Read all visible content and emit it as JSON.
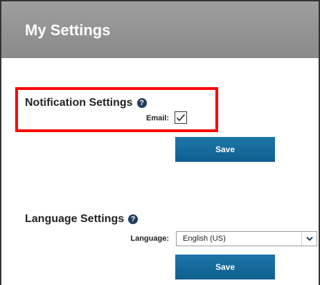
{
  "header": {
    "title": "My Settings"
  },
  "notification": {
    "title": "Notification Settings",
    "help_icon": "?",
    "email_label": "Email:",
    "email_checked": true,
    "save_label": "Save"
  },
  "language": {
    "title": "Language Settings",
    "help_icon": "?",
    "language_label": "Language:",
    "language_value": "English (US)",
    "save_label": "Save"
  },
  "colors": {
    "header_bg": "#8f8f8f",
    "button_bg": "#1569a0",
    "highlight": "#ff0000",
    "help_icon_bg": "#1f3d5c"
  },
  "icons": [
    "help-icon",
    "checkmark-icon",
    "chevron-down-icon"
  ]
}
